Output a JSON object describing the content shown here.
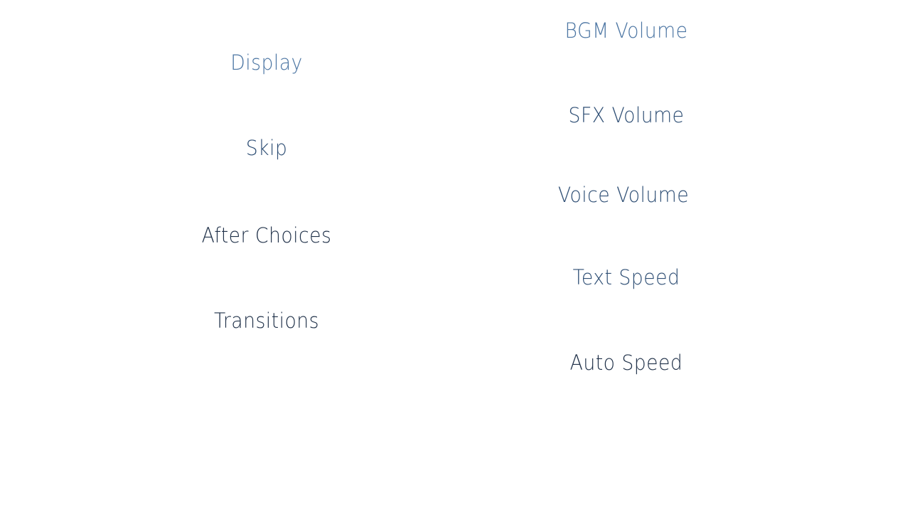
{
  "left_column": {
    "display": "Display",
    "skip": "Skip",
    "after_choices": "After Choices",
    "transitions": "Transitions"
  },
  "right_column": {
    "bgm_volume": "BGM Volume",
    "sfx_volume": "SFX Volume",
    "voice_volume": "Voice Volume",
    "text_speed": "Text Speed",
    "auto_speed": "Auto Speed"
  },
  "colors": {
    "background": "#ffffff",
    "label_light": "#4a74a2",
    "label_mid": "#2f4f75",
    "label_dark": "#1f3048"
  }
}
